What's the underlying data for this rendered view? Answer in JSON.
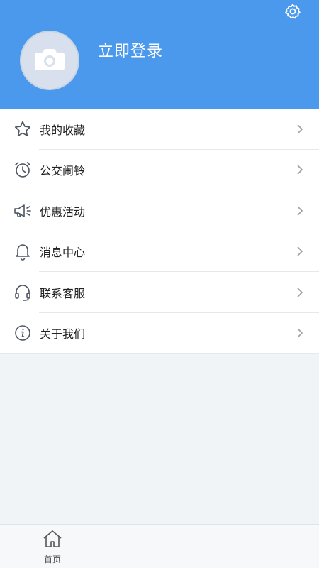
{
  "header": {
    "login_label": "立即登录",
    "background_color": "#4a99ec",
    "settings_icon": "gear-icon",
    "avatar_icon": "camera-icon"
  },
  "menu": {
    "items": [
      {
        "label": "我的收藏",
        "icon": "star-icon"
      },
      {
        "label": "公交闹铃",
        "icon": "alarm-clock-icon"
      },
      {
        "label": "优惠活动",
        "icon": "megaphone-icon"
      },
      {
        "label": "消息中心",
        "icon": "bell-icon"
      },
      {
        "label": "联系客服",
        "icon": "headset-icon"
      },
      {
        "label": "关于我们",
        "icon": "info-icon"
      }
    ]
  },
  "tabbar": {
    "tabs": [
      {
        "label": "首页",
        "icon": "home-icon"
      }
    ]
  }
}
